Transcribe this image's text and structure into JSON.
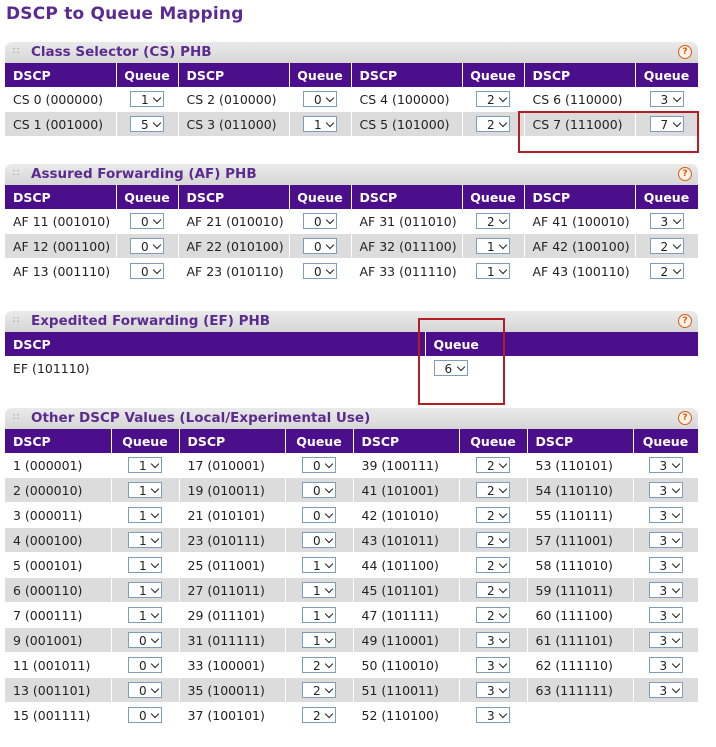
{
  "page_title": "DSCP to Queue Mapping",
  "headers": {
    "dscp": "DSCP",
    "queue": "Queue"
  },
  "cs": {
    "title": "Class Selector (CS) PHB",
    "rows": [
      [
        [
          "CS 0 (000000)",
          "1"
        ],
        [
          "CS 2 (010000)",
          "0"
        ],
        [
          "CS 4 (100000)",
          "2"
        ],
        [
          "CS 6 (110000)",
          "3"
        ]
      ],
      [
        [
          "CS 1 (001000)",
          "5"
        ],
        [
          "CS 3 (011000)",
          "1"
        ],
        [
          "CS 5 (101000)",
          "2"
        ],
        [
          "CS 7 (111000)",
          "7"
        ]
      ]
    ]
  },
  "af": {
    "title": "Assured Forwarding (AF) PHB",
    "rows": [
      [
        [
          "AF 11 (001010)",
          "0"
        ],
        [
          "AF 21 (010010)",
          "0"
        ],
        [
          "AF 31 (011010)",
          "2"
        ],
        [
          "AF 41 (100010)",
          "3"
        ]
      ],
      [
        [
          "AF 12 (001100)",
          "0"
        ],
        [
          "AF 22 (010100)",
          "0"
        ],
        [
          "AF 32 (011100)",
          "1"
        ],
        [
          "AF 42 (100100)",
          "2"
        ]
      ],
      [
        [
          "AF 13 (001110)",
          "0"
        ],
        [
          "AF 23 (010110)",
          "0"
        ],
        [
          "AF 33 (011110)",
          "1"
        ],
        [
          "AF 43 (100110)",
          "2"
        ]
      ]
    ]
  },
  "ef": {
    "title": "Expedited Forwarding (EF) PHB",
    "dscp": "EF (101110)",
    "queue": "6"
  },
  "other": {
    "title": "Other DSCP Values (Local/Experimental Use)",
    "rows": [
      [
        [
          "1 (000001)",
          "1"
        ],
        [
          "17 (010001)",
          "0"
        ],
        [
          "39 (100111)",
          "2"
        ],
        [
          "53 (110101)",
          "3"
        ]
      ],
      [
        [
          "2 (000010)",
          "1"
        ],
        [
          "19 (010011)",
          "0"
        ],
        [
          "41 (101001)",
          "2"
        ],
        [
          "54 (110110)",
          "3"
        ]
      ],
      [
        [
          "3 (000011)",
          "1"
        ],
        [
          "21 (010101)",
          "0"
        ],
        [
          "42 (101010)",
          "2"
        ],
        [
          "55 (110111)",
          "3"
        ]
      ],
      [
        [
          "4 (000100)",
          "1"
        ],
        [
          "23 (010111)",
          "0"
        ],
        [
          "43 (101011)",
          "2"
        ],
        [
          "57 (111001)",
          "3"
        ]
      ],
      [
        [
          "5 (000101)",
          "1"
        ],
        [
          "25 (011001)",
          "1"
        ],
        [
          "44 (101100)",
          "2"
        ],
        [
          "58 (111010)",
          "3"
        ]
      ],
      [
        [
          "6 (000110)",
          "1"
        ],
        [
          "27 (011011)",
          "1"
        ],
        [
          "45 (101101)",
          "2"
        ],
        [
          "59 (111011)",
          "3"
        ]
      ],
      [
        [
          "7 (000111)",
          "1"
        ],
        [
          "29 (011101)",
          "1"
        ],
        [
          "47 (101111)",
          "2"
        ],
        [
          "60 (111100)",
          "3"
        ]
      ],
      [
        [
          "9 (001001)",
          "0"
        ],
        [
          "31 (011111)",
          "1"
        ],
        [
          "49 (110001)",
          "3"
        ],
        [
          "61 (111101)",
          "3"
        ]
      ],
      [
        [
          "11 (001011)",
          "0"
        ],
        [
          "33 (100001)",
          "2"
        ],
        [
          "50 (110010)",
          "3"
        ],
        [
          "62 (111110)",
          "3"
        ]
      ],
      [
        [
          "13 (001101)",
          "0"
        ],
        [
          "35 (100011)",
          "2"
        ],
        [
          "51 (110011)",
          "3"
        ],
        [
          "63 (111111)",
          "3"
        ]
      ],
      [
        [
          "15 (001111)",
          "0"
        ],
        [
          "37 (100101)",
          "2"
        ],
        [
          "52 (110100)",
          "3"
        ],
        null
      ]
    ]
  },
  "colors": {
    "title": "#5B2C8F",
    "header_bg": "#4B0F8C",
    "alt_row": "#dcdcdc",
    "highlight": "#b21e23"
  }
}
